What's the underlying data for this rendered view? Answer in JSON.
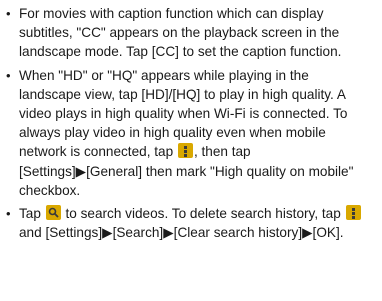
{
  "bullets": [
    {
      "parts": [
        {
          "t": "text",
          "v": "For movies with caption function which can display subtitles, \"CC\" appears on the playback screen in the landscape mode. Tap [CC] to set the caption function."
        }
      ]
    },
    {
      "parts": [
        {
          "t": "text",
          "v": "When \"HD\" or \"HQ\" appears while playing in the landscape view, tap [HD]/[HQ] to play in high quality. A video plays in high quality when Wi-Fi is connected. To always play video in high quality even when mobile network is connected, tap "
        },
        {
          "t": "icon",
          "v": "menu-icon"
        },
        {
          "t": "text",
          "v": ", then tap [Settings]▶[General] then mark \"High quality on mobile\" checkbox."
        }
      ]
    },
    {
      "parts": [
        {
          "t": "text",
          "v": "Tap "
        },
        {
          "t": "icon",
          "v": "search-icon"
        },
        {
          "t": "text",
          "v": " to search videos. To delete search history, tap "
        },
        {
          "t": "icon",
          "v": "menu-icon"
        },
        {
          "t": "text",
          "v": " and [Settings]▶[Search]▶[Clear search history]▶[OK]."
        }
      ]
    }
  ],
  "bullet_symbol": "•",
  "colors": {
    "icon_background": "#d9a800",
    "text": "#1a1a1a"
  }
}
